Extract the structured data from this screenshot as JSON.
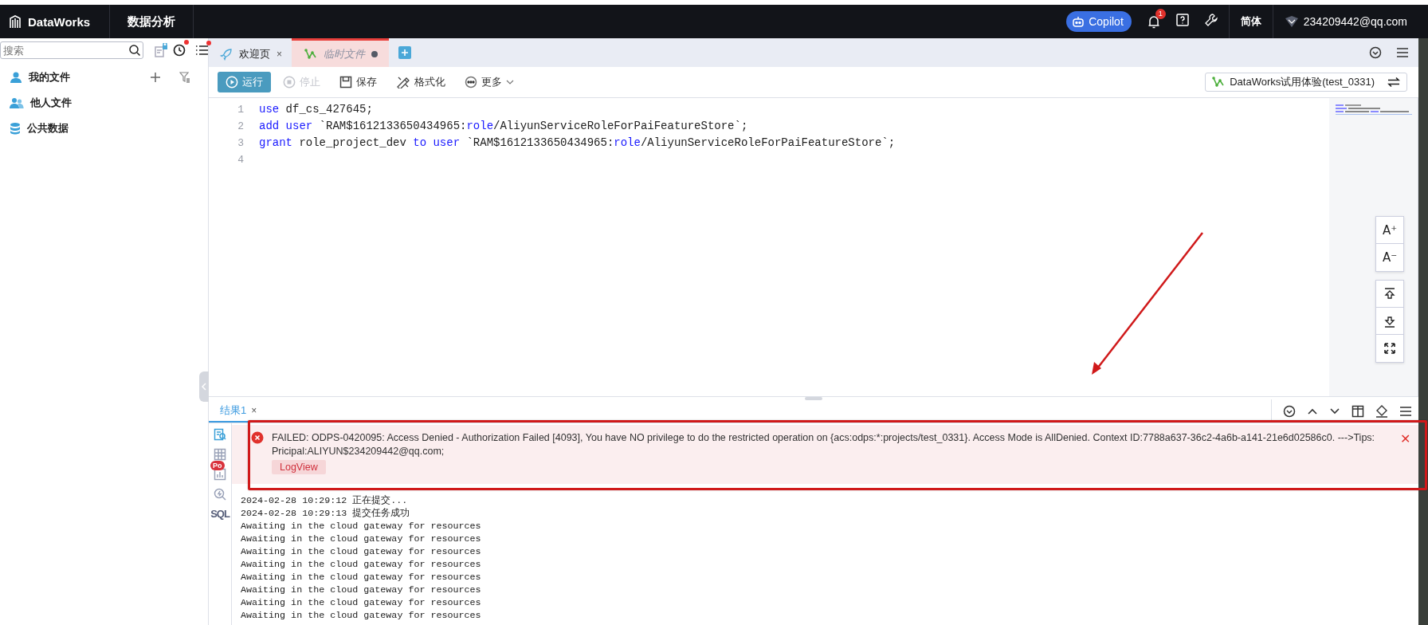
{
  "top_bar": {
    "product": "DataWorks",
    "module": "数据分析",
    "copilot": "Copilot",
    "notification_count": "1",
    "language": "简体",
    "account": "234209442@qq.com"
  },
  "sidebar": {
    "search": {
      "placeholder": "搜索"
    },
    "tree": [
      {
        "label": "我的文件",
        "kind": "person"
      },
      {
        "label": "他人文件",
        "kind": "people"
      },
      {
        "label": "公共数据",
        "kind": "database"
      }
    ]
  },
  "tabs": [
    {
      "label": "欢迎页",
      "kind": "welcome",
      "selected": false,
      "unsaved": false,
      "close": "×"
    },
    {
      "label": "临时文件",
      "kind": "sql",
      "selected": true,
      "unsaved": true
    }
  ],
  "toolbar": {
    "buttons": [
      {
        "label": "运行",
        "kind": "run",
        "disabled": false
      },
      {
        "label": "停止",
        "kind": "stop",
        "disabled": true
      },
      {
        "label": "保存",
        "kind": "save",
        "disabled": false
      },
      {
        "label": "格式化",
        "kind": "format",
        "disabled": false
      },
      {
        "label": "更多",
        "kind": "more",
        "disabled": false
      }
    ],
    "resource_group": "DataWorks试用体验(test_0331)"
  },
  "editor": {
    "lines": [
      {
        "number": "1",
        "tokens": [
          {
            "text": "use",
            "kind": "keyword"
          },
          {
            "text": " df_cs_427645;",
            "kind": "plain"
          }
        ]
      },
      {
        "number": "2",
        "tokens": [
          {
            "text": "add user",
            "kind": "keyword"
          },
          {
            "text": " `RAM$1612133650434965:",
            "kind": "plain"
          },
          {
            "text": "role",
            "kind": "keyword"
          },
          {
            "text": "/AliyunServiceRoleForPaiFeatureStore`;",
            "kind": "plain"
          }
        ]
      },
      {
        "number": "3",
        "tokens": [
          {
            "text": "grant",
            "kind": "keyword"
          },
          {
            "text": " role_project_dev ",
            "kind": "plain"
          },
          {
            "text": "to user",
            "kind": "keyword"
          },
          {
            "text": " `RAM$1612133650434965:",
            "kind": "plain"
          },
          {
            "text": "role",
            "kind": "keyword"
          },
          {
            "text": "/AliyunServiceRoleForPaiFeatureStore`;",
            "kind": "plain"
          }
        ]
      },
      {
        "number": "4"
      }
    ],
    "font_buttons": [
      "A⁺",
      "A⁻"
    ]
  },
  "results": {
    "tabs": [
      {
        "label": "结果1",
        "selected": true,
        "close": "×"
      }
    ],
    "side_label": "SQL",
    "side_badge": "Po",
    "error": {
      "message": "FAILED: ODPS-0420095: Access Denied - Authorization Failed [4093], You have NO privilege to do the restricted operation on {acs:odps:*:projects/test_0331}. Access Mode is AllDenied. Context ID:7788a637-36c2-4a6b-a141-21e6d02586c0. --->Tips: Pricipal:ALIYUN$234209442@qq.com;",
      "link": "LogView",
      "close": "✕"
    },
    "log": [
      "2024-02-28 10:29:12 正在提交...",
      "2024-02-28 10:29:13 提交任务成功",
      "Awaiting in the cloud gateway for resources",
      "Awaiting in the cloud gateway for resources",
      "Awaiting in the cloud gateway for resources",
      "Awaiting in the cloud gateway for resources",
      "Awaiting in the cloud gateway for resources",
      "Awaiting in the cloud gateway for resources",
      "Awaiting in the cloud gateway for resources",
      "Awaiting in the cloud gateway for resources"
    ]
  }
}
